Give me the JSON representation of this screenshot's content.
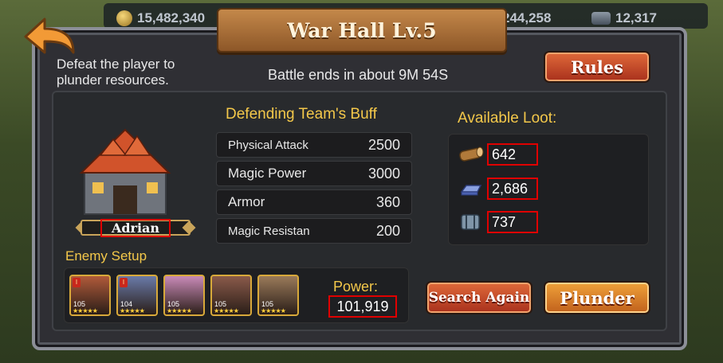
{
  "resources": [
    {
      "icon": "gold-coin-icon",
      "value": "15,482,340"
    },
    {
      "icon": "barrel-icon",
      "value": "244,258"
    },
    {
      "icon": "barrel-icon",
      "value": "12,317"
    }
  ],
  "title": "War Hall Lv.5",
  "instructions": "Defeat the player to plunder resources.",
  "battle_timer": "Battle ends in about 9M 54S",
  "rules_label": "Rules",
  "enemy": {
    "name": "Adrian"
  },
  "buff": {
    "title": "Defending Team's Buff",
    "rows": [
      {
        "label": "Physical Attack",
        "value": "2500"
      },
      {
        "label": "Magic Power",
        "value": "3000"
      },
      {
        "label": "Armor",
        "value": "360"
      },
      {
        "label": "Magic Resistan",
        "value": "200"
      }
    ]
  },
  "loot": {
    "title": "Available Loot:",
    "items": [
      {
        "icon": "wood-log-icon",
        "value": "642"
      },
      {
        "icon": "iron-ingot-icon",
        "value": "2,686"
      },
      {
        "icon": "metal-barrel-icon",
        "value": "737"
      }
    ]
  },
  "enemy_setup": {
    "title": "Enemy Setup",
    "heroes": [
      {
        "level": "105",
        "rank": "I",
        "stars": 5,
        "color": "#b05a3a"
      },
      {
        "level": "104",
        "rank": "I",
        "stars": 5,
        "color": "#6a7aa8"
      },
      {
        "level": "105",
        "rank": "",
        "stars": 5,
        "color": "#c98ab8"
      },
      {
        "level": "105",
        "rank": "",
        "stars": 5,
        "color": "#8a5a4a"
      },
      {
        "level": "105",
        "rank": "",
        "stars": 5,
        "color": "#9a7a5a"
      }
    ]
  },
  "power": {
    "label": "Power:",
    "value": "101,919"
  },
  "buttons": {
    "search_again": "Search Again",
    "plunder": "Plunder"
  }
}
